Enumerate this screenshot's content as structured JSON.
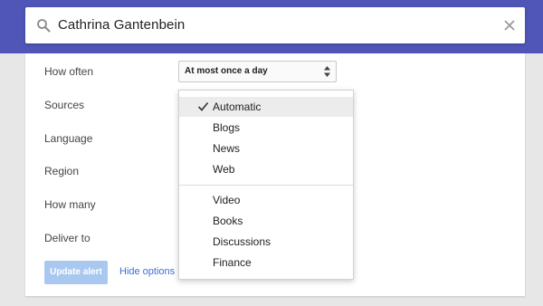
{
  "search": {
    "query": "Cathrina Gantenbein"
  },
  "form": {
    "labels": [
      "How often",
      "Sources",
      "Language",
      "Region",
      "How many",
      "Deliver to"
    ],
    "how_often_value": "At most once a day",
    "update_button": "Update alert",
    "hide_options_link": "Hide options"
  },
  "sources_dropdown": {
    "selected": "Automatic",
    "group1": [
      "Automatic",
      "Blogs",
      "News",
      "Web"
    ],
    "group2": [
      "Video",
      "Books",
      "Discussions",
      "Finance"
    ]
  },
  "colors": {
    "header_band": "#4f56b7",
    "update_button": "#a9c8f0",
    "link": "#3b6fd6"
  }
}
